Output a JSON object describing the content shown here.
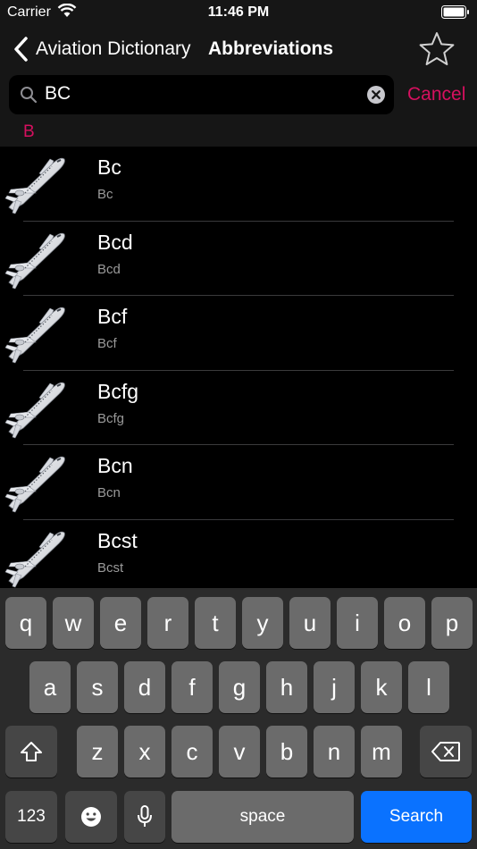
{
  "status_bar": {
    "carrier": "Carrier",
    "time": "11:46 PM"
  },
  "nav": {
    "back_label": "Aviation Dictionary",
    "title": "Abbreviations"
  },
  "search": {
    "value": "BC",
    "cancel_label": "Cancel"
  },
  "section": {
    "letter": "B"
  },
  "colors": {
    "accent": "#d6105f",
    "keyboard_blue": "#0a72ff"
  },
  "list": {
    "rows": [
      {
        "title": "Bc",
        "subtitle": "Bc"
      },
      {
        "title": "Bcd",
        "subtitle": "Bcd"
      },
      {
        "title": "Bcf",
        "subtitle": "Bcf"
      },
      {
        "title": "Bcfg",
        "subtitle": "Bcfg"
      },
      {
        "title": "Bcn",
        "subtitle": "Bcn"
      },
      {
        "title": "Bcst",
        "subtitle": "Bcst"
      }
    ]
  },
  "keyboard": {
    "row1": [
      "q",
      "w",
      "e",
      "r",
      "t",
      "y",
      "u",
      "i",
      "o",
      "p"
    ],
    "row2": [
      "a",
      "s",
      "d",
      "f",
      "g",
      "h",
      "j",
      "k",
      "l"
    ],
    "row3": [
      "z",
      "x",
      "c",
      "v",
      "b",
      "n",
      "m"
    ],
    "numbers_label": "123",
    "space_label": "space",
    "search_label": "Search"
  }
}
